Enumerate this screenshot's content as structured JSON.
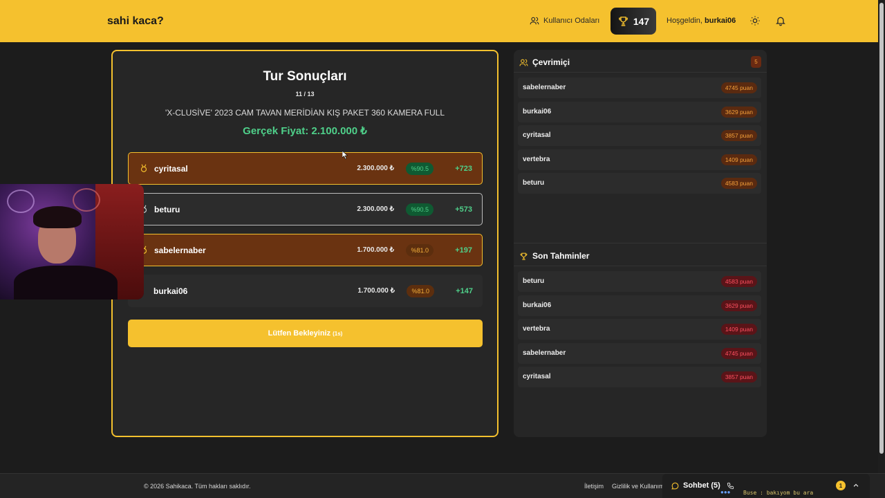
{
  "header": {
    "brand": "sahi kaca?",
    "rooms_link": "Kullanıcı Odaları",
    "score": "147",
    "welcome_prefix": "Hoşgeldin,",
    "username": "burkai06"
  },
  "round": {
    "title": "Tur Sonuçları",
    "counter": "11 / 13",
    "product": "'X-CLUSİVE' 2023 CAM TAVAN MERİDİAN KIŞ PAKET 360 KAMERA FULL",
    "real_price": "Gerçek Fiyat: 2.100.000 ₺",
    "results": [
      {
        "name": "cyritasal",
        "guess": "2.300.000 ₺",
        "accuracy": "%90.5",
        "points": "+723",
        "style": "gold",
        "acc_color": "green"
      },
      {
        "name": "beturu",
        "guess": "2.300.000 ₺",
        "accuracy": "%90.5",
        "points": "+573",
        "style": "silver",
        "acc_color": "green"
      },
      {
        "name": "sabelernaber",
        "guess": "1.700.000 ₺",
        "accuracy": "%81.0",
        "points": "+197",
        "style": "gold",
        "acc_color": "amber"
      },
      {
        "name": "burkai06",
        "guess": "1.700.000 ₺",
        "accuracy": "%81.0",
        "points": "+147",
        "style": "plain",
        "acc_color": "amber"
      }
    ],
    "wait_label": "Lütfen Bekleyiniz",
    "wait_countdown": "(1s)"
  },
  "online": {
    "title": "Çevrimiçi",
    "count": "5",
    "users": [
      {
        "name": "sabelernaber",
        "points": "4745 puan"
      },
      {
        "name": "burkai06",
        "points": "3629 puan"
      },
      {
        "name": "cyritasal",
        "points": "3857 puan"
      },
      {
        "name": "vertebra",
        "points": "1409 puan"
      },
      {
        "name": "beturu",
        "points": "4583 puan"
      }
    ]
  },
  "recent": {
    "title": "Son Tahminler",
    "users": [
      {
        "name": "beturu",
        "points": "4583 puan"
      },
      {
        "name": "burkai06",
        "points": "3629 puan"
      },
      {
        "name": "vertebra",
        "points": "1409 puan"
      },
      {
        "name": "sabelernaber",
        "points": "4745 puan"
      },
      {
        "name": "cyritasal",
        "points": "3857 puan"
      }
    ]
  },
  "footer": {
    "copyright": "© 2026 Sahikaca. Tüm hakları saklıdır.",
    "contact": "İletişim",
    "privacy": "Gizlilik ve Kullanım",
    "chat_label": "Sohbet (5)",
    "chat_unread": "1",
    "ticker": "Buse : bakıyom bu ara"
  },
  "colors": {
    "accent": "#f5c12e",
    "success": "#4fd08a",
    "danger": "#ff5060",
    "background": "#1c1c1c",
    "panel": "#262626"
  },
  "icons": [
    "users-icon",
    "trophy-icon",
    "sun-icon",
    "bell-icon",
    "medal-icon",
    "chat-icon",
    "phone-icon",
    "chevron-up-icon"
  ]
}
